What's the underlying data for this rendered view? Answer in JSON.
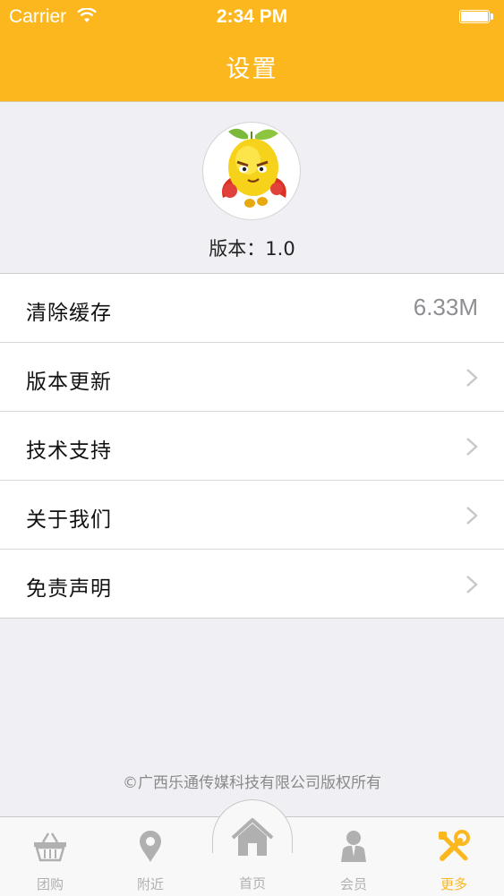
{
  "status_bar": {
    "carrier": "Carrier",
    "time": "2:34 PM",
    "battery_level": 1.0
  },
  "nav": {
    "title": "设置"
  },
  "profile": {
    "avatar_icon": "mango-mascot-icon",
    "version_label": "版本：1.0"
  },
  "settings": {
    "items": [
      {
        "label": "清除缓存",
        "value": "6.33M"
      },
      {
        "label": "版本更新",
        "icon": "chevron-right-icon"
      },
      {
        "label": "技术支持",
        "icon": "chevron-right-icon"
      },
      {
        "label": "关于我们",
        "icon": "chevron-right-icon"
      },
      {
        "label": "免责声明",
        "icon": "chevron-right-icon"
      }
    ]
  },
  "footer": {
    "copyright": "©广西乐通传媒科技有限公司版权所有"
  },
  "tab_bar": {
    "items": [
      {
        "label": "团购",
        "icon": "basket-icon"
      },
      {
        "label": "附近",
        "icon": "location-pin-icon"
      },
      {
        "label": "首页",
        "icon": "home-icon"
      },
      {
        "label": "会员",
        "icon": "member-icon"
      },
      {
        "label": "更多",
        "icon": "tools-icon",
        "active": true
      }
    ]
  },
  "colors": {
    "accent": "#fcb71e",
    "background": "#efeff4",
    "inactive_tab": "#b0b0b0"
  }
}
